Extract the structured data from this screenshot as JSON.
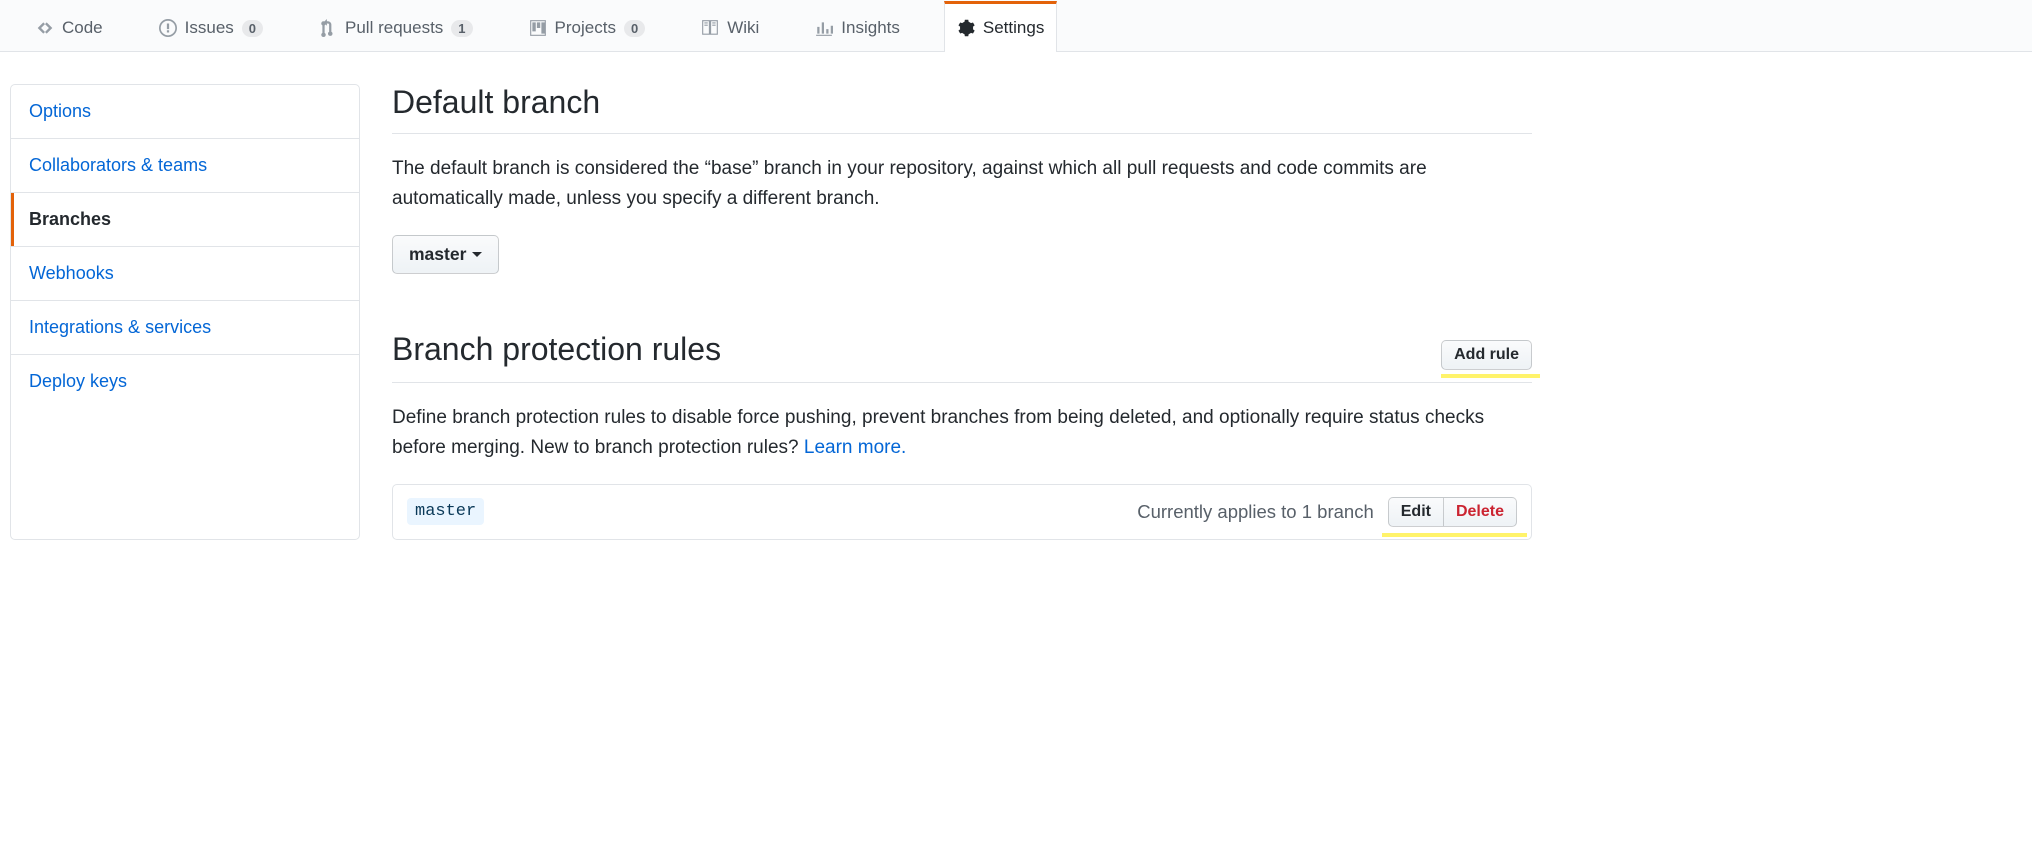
{
  "tabs": [
    {
      "label": "Code",
      "count": null
    },
    {
      "label": "Issues",
      "count": "0"
    },
    {
      "label": "Pull requests",
      "count": "1"
    },
    {
      "label": "Projects",
      "count": "0"
    },
    {
      "label": "Wiki",
      "count": null
    },
    {
      "label": "Insights",
      "count": null
    },
    {
      "label": "Settings",
      "count": null
    }
  ],
  "sidemenu": [
    "Options",
    "Collaborators & teams",
    "Branches",
    "Webhooks",
    "Integrations & services",
    "Deploy keys"
  ],
  "default_branch": {
    "title": "Default branch",
    "desc": "The default branch is considered the “base” branch in your repository, against which all pull requests and code commits are automatically made, unless you specify a different branch.",
    "selected": "master"
  },
  "protection": {
    "title": "Branch protection rules",
    "add_label": "Add rule",
    "desc_prefix": "Define branch protection rules to disable force pushing, prevent branches from being deleted, and optionally require status checks before merging. New to branch protection rules? ",
    "learn_more": "Learn more.",
    "rule": {
      "branch": "master",
      "applies": "Currently applies to 1 branch",
      "edit": "Edit",
      "delete": "Delete"
    }
  }
}
